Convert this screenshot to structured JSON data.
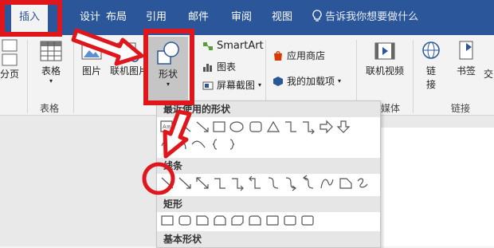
{
  "tabs": {
    "insert": "插入",
    "design": "设计",
    "layout": "布局",
    "references": "引用",
    "mailings": "邮件",
    "review": "审阅",
    "view": "视图",
    "tell_me": "告诉我你想要做什么"
  },
  "ribbon": {
    "page_break": "分页",
    "table": "表格",
    "table_group": "表格",
    "picture": "图片",
    "online_picture": "联机图片",
    "shapes": "形状",
    "smartart": "SmartArt",
    "chart": "图表",
    "screenshot": "屏幕截图",
    "store": "应用商店",
    "my_addins": "我的加载项",
    "online_video": "联机视频",
    "media_group": "媒体",
    "link": "链",
    "link2": "接",
    "bookmark": "书签",
    "cross_ref": "交",
    "links_group": "链接"
  },
  "gallery": {
    "recent": "最近使用的形状",
    "lines": "线条",
    "rectangles": "矩形",
    "basic": "基本形状"
  },
  "colors": {
    "ribbon_blue": "#2b579a",
    "annotation_red": "#e0161d"
  }
}
